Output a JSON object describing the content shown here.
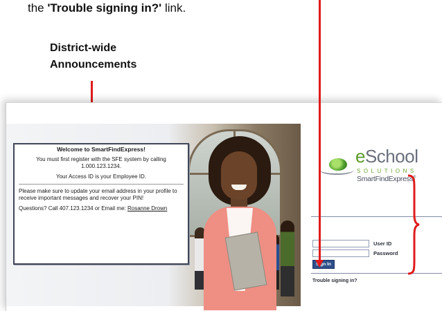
{
  "captions": {
    "top_prefix": "the ",
    "top_link": "'Trouble signing in?'",
    "top_suffix": " link.",
    "announcements": "District-wide Announcements"
  },
  "announcement_box": {
    "title": "Welcome to SmartFindExpress!",
    "line1": "You must first register with the SFE system by calling 1.000.123.1234.",
    "line2": "Your Access ID is your Employee ID.",
    "line3": "Please make sure to update your email address in your profile to receive important messages and recover your PIN!",
    "line4_prefix": "Questions? Call 407.123.1234 or Email me: ",
    "contact_link": "Rosanne Drown"
  },
  "logo": {
    "brand_e": "e",
    "brand_rest": "School",
    "brand_sub": "SOLUTIONS",
    "product": "SmartFindExpress",
    "product_mark": "®"
  },
  "login": {
    "user_id_label": "User ID",
    "password_label": "Password",
    "user_id_value": "",
    "password_value": "",
    "signin_button": "Sign In",
    "trouble_link": "Trouble signing in?"
  },
  "colors": {
    "arrow": "#e01b1b",
    "brand_green": "#5a9a2e",
    "brand_gray": "#6a707c",
    "button_blue": "#2e4f8a"
  },
  "icons": {
    "logo": "eschool-globe-icon",
    "bracket": "curly-brace-icon"
  }
}
